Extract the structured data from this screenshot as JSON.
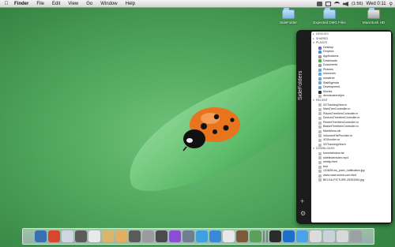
{
  "menubar": {
    "apple": "",
    "items": [
      "Finder",
      "File",
      "Edit",
      "View",
      "Go",
      "Window",
      "Help"
    ],
    "clock": "Wed 0:11",
    "battery": "(1:56)"
  },
  "desktop_icons": [
    {
      "label": "SideFolder"
    },
    {
      "label": "Expected DMG Files"
    },
    {
      "label": "Macintosh HD"
    }
  ],
  "panel": {
    "title": "SideFolders",
    "plus": "+",
    "gear": "⚙",
    "sections": [
      {
        "label": "DEVICES",
        "items": []
      },
      {
        "label": "SHARED",
        "items": []
      },
      {
        "label": "PLACES",
        "items": [
          {
            "label": "Desktop",
            "color": "#7c5cd6"
          },
          {
            "label": "Dropbox",
            "color": "#4a90e2"
          },
          {
            "label": "Applications",
            "color": "#9a9a9a"
          },
          {
            "label": "Downloads",
            "color": "#4caf50"
          },
          {
            "label": "Documents",
            "color": "#9a9a9a"
          },
          {
            "label": "Pictures",
            "color": "#6aa9dd"
          },
          {
            "label": "resources",
            "color": "#6aa9dd"
          },
          {
            "label": "showtree",
            "color": "#6aa9dd"
          },
          {
            "label": "StaffAgenda",
            "color": "#6aa9dd"
          },
          {
            "label": "Development",
            "color": "#6aa9dd"
          },
          {
            "label": "Movies",
            "color": "#333"
          },
          {
            "label": "dennisvanmeijen",
            "color": "#bbb"
          }
        ]
      },
      {
        "label": "RECENT",
        "items": [
          {
            "label": "XDTrackingView.m",
            "color": "#bbb"
          },
          {
            "label": "MainTreeController.m",
            "color": "#bbb"
          },
          {
            "label": "PlacesTreeItemController.m",
            "color": "#bbb"
          },
          {
            "label": "DevicesTreeItemController.m",
            "color": "#bbb"
          },
          {
            "label": "RecentTreeItemController.m",
            "color": "#bbb"
          },
          {
            "label": "BasketTreeItemController.m",
            "color": "#bbb"
          },
          {
            "label": "MainMenu.xib",
            "color": "#bbb"
          },
          {
            "label": "VolumesFileProvider.m",
            "color": "#bbb"
          },
          {
            "label": "XDScroller.m",
            "color": "#bbb"
          },
          {
            "label": "XDTrackingView.h",
            "color": "#bbb"
          }
        ]
      },
      {
        "label": "DOWNLOADS",
        "items": [
          {
            "label": "tunnelwindow.tar",
            "color": "#bbb"
          },
          {
            "label": "sidefinderindex.mp4",
            "color": "#bbb"
          },
          {
            "label": "webkp.html",
            "color": "#bbb"
          },
          {
            "label": "test",
            "color": "#bbb"
          },
          {
            "label": "131828-ios_push_notification.jpg",
            "color": "#bbb"
          },
          {
            "label": "www.macrumors.com.html",
            "color": "#bbb"
          },
          {
            "label": "BELGA-PICTURE-25303394.jpg",
            "color": "#bbb"
          }
        ]
      }
    ]
  },
  "dock": [
    "#3a6fb0",
    "#d9462c",
    "#cfd6df",
    "#5b5b5b",
    "#e9e9e9",
    "#d9b66b",
    "#e0b060",
    "#5a5a5a",
    "#9a9aa0",
    "#4b4b4b",
    "#8a4fd0",
    "#6f7f8f",
    "#3fa0e0",
    "#3a88d8",
    "#e8e8e8",
    "#7b5a3a",
    "#5aa05a",
    "#eaeaea",
    "#1c1c1c",
    "#2b2b2b",
    "#1f6fc8",
    "#4aa3e6",
    "#dcdcdc",
    "#c9d2dc",
    "#d8d8d8",
    "#9aa0a6"
  ]
}
